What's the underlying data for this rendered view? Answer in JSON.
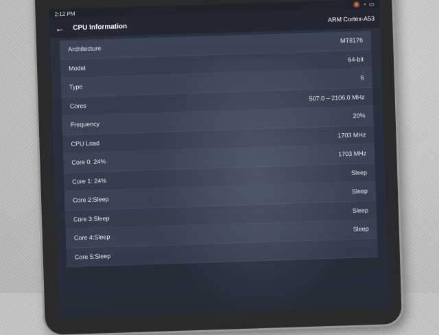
{
  "status": {
    "time": "2:12 PM"
  },
  "toolbar": {
    "title": "CPU Information",
    "right_value": "ARM Cortex-A53"
  },
  "rows": [
    {
      "label": "Architecture",
      "value": "MT8176"
    },
    {
      "label": "Model",
      "value": "64-bit"
    },
    {
      "label": "Type",
      "value": "6"
    },
    {
      "label": "Cores",
      "value": "507.0 – 2106.0 MHz"
    },
    {
      "label": "Frequency",
      "value": "20%"
    },
    {
      "label": "CPU Load",
      "value": "1703 MHz"
    },
    {
      "label": "Core 0: 24%",
      "value": "1703 MHz"
    },
    {
      "label": "Core 1: 24%",
      "value": "Sleep"
    },
    {
      "label": "Core 2:Sleep",
      "value": "Sleep"
    },
    {
      "label": "Core 3:Sleep",
      "value": "Sleep"
    },
    {
      "label": "Core 4:Sleep",
      "value": "Sleep"
    },
    {
      "label": "Core 5:Sleep",
      "value": ""
    }
  ]
}
